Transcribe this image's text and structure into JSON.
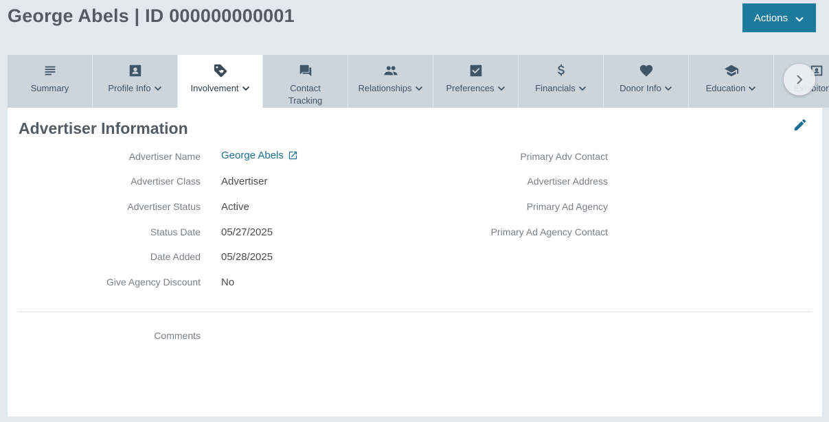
{
  "header": {
    "title": "George Abels | ID 000000000001",
    "actions_label": "Actions"
  },
  "tabs": [
    {
      "label": "Summary",
      "icon": "list-icon",
      "dropdown": false
    },
    {
      "label": "Profile Info",
      "icon": "contact-card-icon",
      "dropdown": true
    },
    {
      "label": "Involvement",
      "icon": "tag-icon",
      "dropdown": true,
      "active": true
    },
    {
      "label": "Contact Tracking",
      "icon": "chat-icon",
      "dropdown": false
    },
    {
      "label": "Relationships",
      "icon": "people-icon",
      "dropdown": true
    },
    {
      "label": "Preferences",
      "icon": "checkbox-icon",
      "dropdown": true
    },
    {
      "label": "Financials",
      "icon": "dollar-icon",
      "dropdown": true
    },
    {
      "label": "Donor Info",
      "icon": "heart-icon",
      "dropdown": true
    },
    {
      "label": "Education",
      "icon": "graduation-cap-icon",
      "dropdown": true
    },
    {
      "label": "Exhibitor In",
      "icon": "badge-icon",
      "dropdown": false
    }
  ],
  "section": {
    "title": "Advertiser Information"
  },
  "fields_left": [
    {
      "label": "Advertiser Name",
      "value": "George Abels",
      "link": true
    },
    {
      "label": "Advertiser Class",
      "value": "Advertiser"
    },
    {
      "label": "Advertiser Status",
      "value": "Active"
    },
    {
      "label": "Status Date",
      "value": "05/27/2025"
    },
    {
      "label": "Date Added",
      "value": "05/28/2025"
    },
    {
      "label": "Give Agency Discount",
      "value": "No"
    }
  ],
  "fields_right": [
    {
      "label": "Primary Adv Contact",
      "value": ""
    },
    {
      "label": "Advertiser Address",
      "value": ""
    },
    {
      "label": "Primary Ad Agency",
      "value": ""
    },
    {
      "label": "Primary Ad Agency Contact",
      "value": ""
    }
  ],
  "comments": {
    "label": "Comments",
    "value": ""
  },
  "colors": {
    "accent": "#1e7a9a",
    "link": "#1e6f8f",
    "tab_bg": "#ccd4dc",
    "page_bg": "#e3e8ee"
  }
}
